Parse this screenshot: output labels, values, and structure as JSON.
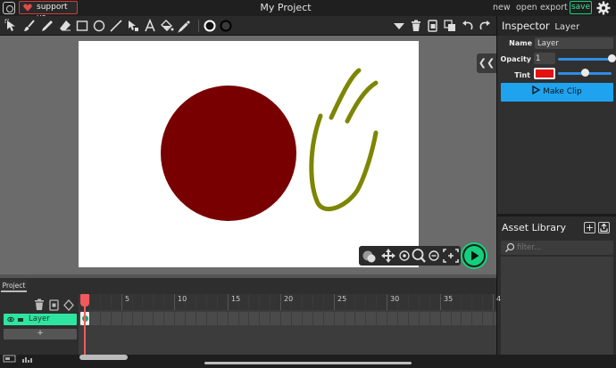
{
  "topbar": {
    "support_label": "support us",
    "title": "My Project",
    "new_label": "new",
    "open_label": "open",
    "export_label": "export",
    "save_label": "save"
  },
  "toolbar": {
    "tools": [
      "cursor-icon",
      "brush-icon",
      "pencil-icon",
      "eraser-icon",
      "rectangle-icon",
      "circle-icon",
      "line-icon",
      "pathpoint-icon",
      "text-icon",
      "fill-bucket-icon",
      "eyedropper-icon"
    ],
    "right_tools": [
      "dropdown-arrow-icon",
      "trash-icon",
      "copy-icon",
      "send-back-icon",
      "bring-front-icon",
      "undo-icon",
      "redo-icon"
    ]
  },
  "stage": {
    "circle_color": "#780000",
    "stroke_color": "#7d8600",
    "background": "#ffffff"
  },
  "inspector": {
    "title": "Inspector",
    "subtitle": "Layer",
    "name_label": "Name",
    "name_value": "Layer",
    "opacity_label": "Opacity",
    "opacity_value": "1",
    "opacity_fraction": 1.0,
    "tint_label": "Tint",
    "tint_color": "#e31111",
    "tint_fraction": 0.5,
    "make_clip_label": "Make Clip"
  },
  "asset_library": {
    "title": "Asset Library",
    "filter_placeholder": "filter..."
  },
  "timeline": {
    "tab_label": "Project",
    "frame_numbers": [
      "5",
      "10",
      "15",
      "20",
      "25",
      "30",
      "35",
      "4"
    ],
    "layer_name": "Layer",
    "add_layer_label": "+",
    "current_frame": 1
  },
  "colors": {
    "accent_green": "#14d07c",
    "accent_blue": "#1fa3ef",
    "playhead_red": "#f15a5a",
    "layer_green": "#2fe4a0"
  }
}
